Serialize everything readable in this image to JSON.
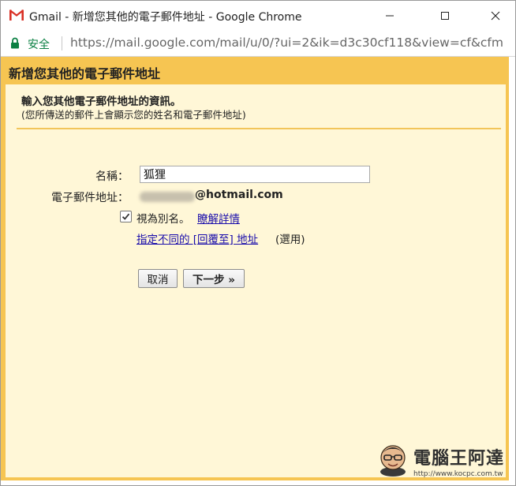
{
  "window": {
    "title": "Gmail - 新增您其他的電子郵件地址 - Google Chrome",
    "icon": "gmail-icon",
    "controls": [
      "minimize-icon",
      "maximize-icon",
      "close-icon"
    ]
  },
  "addressbar": {
    "secure_label": "安全",
    "url": "https://mail.google.com/mail/u/0/?ui=2&ik=d3c30cf118&view=cf&cfm"
  },
  "dialog": {
    "title": "新增您其他的電子郵件地址",
    "section_title": "輸入您其他電子郵件地址的資訊。",
    "section_sub": "(您所傳送的郵件上會顯示您的姓名和電子郵件地址)",
    "name_label": "名稱：",
    "name_value": "狐狸",
    "email_label": "電子郵件地址：",
    "email_domain": "@hotmail.com",
    "alias_checked": true,
    "alias_label": "視為別名。",
    "learn_more_link": "瞭解詳情",
    "reply_to_link": "指定不同的 [回覆至] 地址",
    "optional_label": "(選用)",
    "cancel_button": "取消",
    "next_button": "下一步 »"
  },
  "watermark": {
    "text": "電腦王阿達",
    "url": "http://www.kocpc.com.tw"
  },
  "colors": {
    "dialog_border": "#f6c552",
    "dialog_background": "#fff7d7",
    "link": "#1a0dab",
    "secure": "#0b8043"
  }
}
